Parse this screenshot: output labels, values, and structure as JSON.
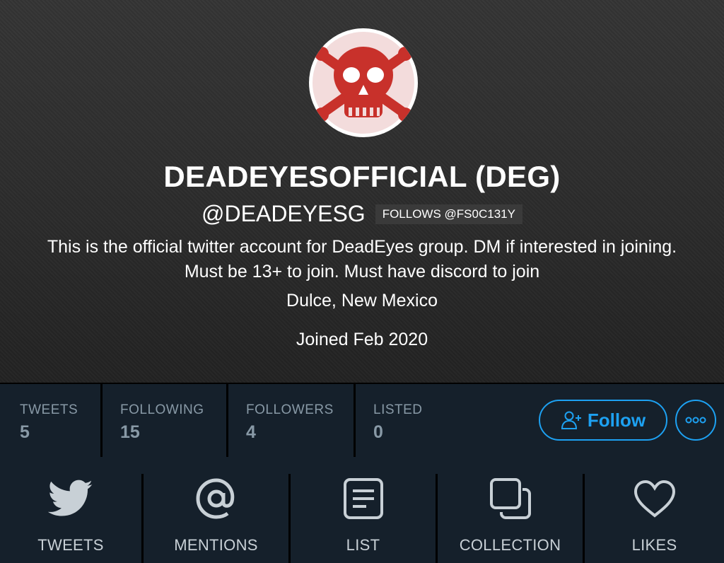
{
  "profile": {
    "display_name": "DEADEYESOFFICIAL (DEG)",
    "handle": "@DEADEYESG",
    "follows_badge": "FOLLOWS @FS0C131Y",
    "bio": "This is the official twitter account for DeadEyes group. DM if interested in joining. Must be 13+ to join. Must have discord to join",
    "location": "Dulce, New Mexico",
    "joined": "Joined Feb 2020",
    "avatar_icon": "skull-crossbones-icon"
  },
  "stats": [
    {
      "label": "TWEETS",
      "value": "5"
    },
    {
      "label": "FOLLOWING",
      "value": "15"
    },
    {
      "label": "FOLLOWERS",
      "value": "4"
    },
    {
      "label": "LISTED",
      "value": "0"
    }
  ],
  "actions": {
    "follow_label": "Follow",
    "follow_icon": "add-user-icon",
    "more_icon": "ellipsis-icon"
  },
  "tabs": [
    {
      "label": "TWEETS",
      "icon": "bird-icon"
    },
    {
      "label": "MENTIONS",
      "icon": "at-sign-icon"
    },
    {
      "label": "LIST",
      "icon": "list-icon"
    },
    {
      "label": "COLLECTION",
      "icon": "collection-icon"
    },
    {
      "label": "LIKES",
      "icon": "heart-icon"
    }
  ],
  "colors": {
    "accent": "#1da1f2",
    "background": "#15202b",
    "muted": "#8899a6",
    "avatar_red": "#c8312b"
  }
}
